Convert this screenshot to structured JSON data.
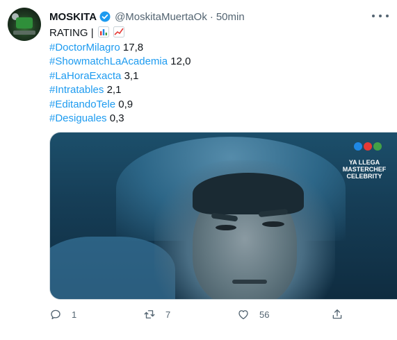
{
  "tweet": {
    "display_name": "MOSKITA",
    "handle": "@MoskitaMuertaOk",
    "separator": "·",
    "time": "50min",
    "rating_label": "RATING |",
    "emojis": [
      "bar-chart-emoji",
      "chart-increasing-emoji"
    ],
    "ratings": [
      {
        "tag": "#DoctorMilagro",
        "value": "17,8"
      },
      {
        "tag": "#ShowmatchLaAcademia",
        "value": "12,0"
      },
      {
        "tag": "#LaHoraExacta",
        "value": "3,1"
      },
      {
        "tag": "#Intratables",
        "value": "2,1"
      },
      {
        "tag": "#EditandoTele",
        "value": "0,9"
      },
      {
        "tag": "#Desiguales",
        "value": "0,3"
      }
    ]
  },
  "media": {
    "promo_text": "YA LLEGA MASTERCHEF CELEBRITY",
    "logo_colors": [
      "#1e88e5",
      "#e53935",
      "#43a047"
    ]
  },
  "actions": {
    "reply_count": "1",
    "retweet_count": "7",
    "like_count": "56"
  },
  "colors": {
    "link": "#1d9bf0",
    "verified": "#1d9bf0",
    "secondary": "#536471"
  }
}
